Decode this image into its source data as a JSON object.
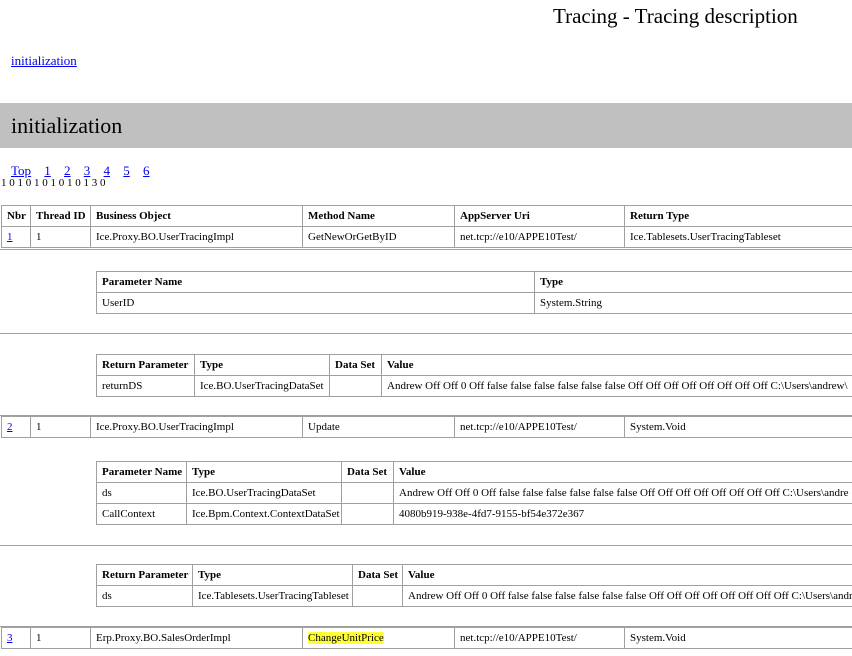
{
  "title": "Tracing - Tracing description",
  "top_link": "initialization",
  "section_header": "initialization",
  "nav": {
    "top": "Top",
    "pages": [
      "1",
      "2",
      "3",
      "4",
      "5",
      "6"
    ]
  },
  "tiny_text": "1 0 1 0 1 0 1 0 1 0 1 3 0",
  "main_headers": [
    "Nbr",
    "Thread ID",
    "Business Object",
    "Method Name",
    "AppServer Uri",
    "Return Type"
  ],
  "calls": [
    {
      "nbr": "1",
      "thread": "1",
      "bo": "Ice.Proxy.BO.UserTracingImpl",
      "method": "GetNewOrGetByID",
      "uri": "net.tcp://e10/APPE10Test/",
      "ret": "Ice.Tablesets.UserTracingTableset"
    },
    {
      "nbr": "2",
      "thread": "1",
      "bo": "Ice.Proxy.BO.UserTracingImpl",
      "method": "Update",
      "uri": "net.tcp://e10/APPE10Test/",
      "ret": "System.Void"
    },
    {
      "nbr": "3",
      "thread": "1",
      "bo": "Erp.Proxy.BO.SalesOrderImpl",
      "method": "ChangeUnitPrice",
      "uri": "net.tcp://e10/APPE10Test/",
      "ret": "System.Void"
    }
  ],
  "param_headers_short": [
    "Parameter Name",
    "Type"
  ],
  "param_headers_full": [
    "Parameter Name",
    "Type",
    "Data Set",
    "Value"
  ],
  "return_headers": [
    "Return Parameter",
    "Type",
    "Data Set",
    "Value"
  ],
  "call1_params": [
    {
      "name": "UserID",
      "type": "System.String"
    }
  ],
  "call1_return": [
    {
      "name": "returnDS",
      "type": "Ice.BO.UserTracingDataSet",
      "dataset": "",
      "value": "Andrew Off Off 0 Off false false false false false false Off Off Off Off Off Off Off Off C:\\Users\\andrew\\"
    }
  ],
  "call2_params": [
    {
      "name": "ds",
      "type": "Ice.BO.UserTracingDataSet",
      "dataset": "",
      "value": "Andrew Off Off 0 Off false false false false false false Off Off Off Off Off Off Off Off C:\\Users\\andre"
    },
    {
      "name": "CallContext",
      "type": "Ice.Bpm.Context.ContextDataSet",
      "dataset": "",
      "value": "4080b919-938e-4fd7-9155-bf54e372e367"
    }
  ],
  "call2_return": [
    {
      "name": "ds",
      "type": "Ice.Tablesets.UserTracingTableset",
      "dataset": "",
      "value": "Andrew Off Off 0 Off false false false false false false Off Off Off Off Off Off Off Off C:\\Users\\andr"
    }
  ],
  "highlight_color": "#ffff33",
  "header_band_color": "#c0c0c0"
}
